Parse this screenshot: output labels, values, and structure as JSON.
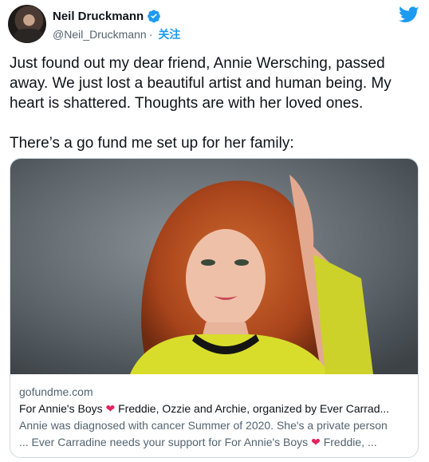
{
  "author": {
    "name": "Neil Druckmann",
    "handle": "@Neil_Druckmann",
    "separator": "·",
    "follow_label": "关注"
  },
  "tweet": {
    "text": "Just found out my dear friend, Annie Wersching, passed away. We just lost a beautiful artist and human being. My heart is shattered. Thoughts are with her loved ones.\n\nThere’s a go fund me set up for her family:"
  },
  "card": {
    "domain": "gofundme.com",
    "title_start": "For Annie's Boys ",
    "heart": "❤",
    "title_end": " Freddie, Ozzie and Archie, organized by Ever Carrad...",
    "desc_line1": "Annie was diagnosed with cancer Summer of 2020. She's a private person",
    "desc_line2_start": "... Ever Carradine needs your support for For Annie's Boys ",
    "desc_line2_end": " Freddie, ..."
  },
  "icons": {
    "verified": "verified-badge-icon",
    "logo": "twitter-bird-icon"
  },
  "colors": {
    "accent": "#1d9bf0",
    "heart": "#e0245e",
    "secondary_text": "#536471"
  }
}
